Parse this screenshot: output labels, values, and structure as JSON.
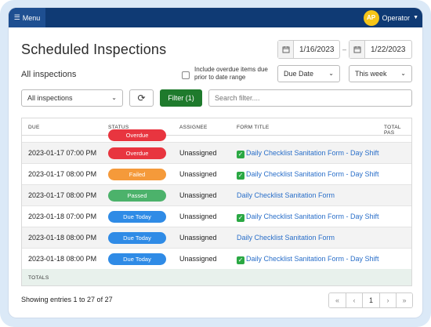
{
  "topbar": {
    "menu_label": "Menu",
    "avatar_initials": "AP",
    "user_name": "Operator"
  },
  "page": {
    "title": "Scheduled Inspections",
    "subtitle": "All inspections"
  },
  "filters": {
    "date_from": "1/16/2023",
    "date_to": "1/22/2023",
    "date_separator": "–",
    "overdue_checkbox_label": "Include overdue items due prior to date range",
    "date_field_select": "Due Date",
    "range_select": "This week",
    "inspections_select": "All inspections",
    "filter_button": "Filter (1)",
    "search_placeholder": "Search filter...."
  },
  "table": {
    "columns": [
      "DUE",
      "STATUS",
      "ASSIGNEE",
      "FORM TITLE",
      "TOTAL PAS"
    ],
    "rows": [
      {
        "due": "2023-01-17 07:00 PM",
        "status": "Overdue",
        "assignee": "Unassigned",
        "form": "Daily Checklist Sanitation Form - Day Shift",
        "checked": true
      },
      {
        "due": "2023-01-17 08:00 PM",
        "status": "Failed",
        "assignee": "Unassigned",
        "form": "Daily Checklist Sanitation Form - Day Shift",
        "checked": true
      },
      {
        "due": "2023-01-17 08:00 PM",
        "status": "Passed",
        "assignee": "Unassigned",
        "form": "Daily Checklist Sanitation Form",
        "checked": false
      },
      {
        "due": "2023-01-18 07:00 PM",
        "status": "Due Today",
        "assignee": "Unassigned",
        "form": "Daily Checklist Sanitation Form - Day Shift",
        "checked": true
      },
      {
        "due": "2023-01-18 08:00 PM",
        "status": "Due Today",
        "assignee": "Unassigned",
        "form": "Daily Checklist Sanitation Form",
        "checked": false
      },
      {
        "due": "2023-01-18 08:00 PM",
        "status": "Due Today",
        "assignee": "Unassigned",
        "form": "Daily Checklist Sanitation Form - Day Shift",
        "checked": true
      }
    ],
    "totals_label": "TOTALS"
  },
  "status_colors": {
    "Overdue": "#e8353f",
    "Failed": "#f59a3a",
    "Passed": "#4cb26b",
    "Due Today": "#2f8be6"
  },
  "footer": {
    "showing": "Showing entries 1 to 27 of 27",
    "pager": [
      "«",
      "‹",
      "1",
      "›",
      "»"
    ]
  }
}
